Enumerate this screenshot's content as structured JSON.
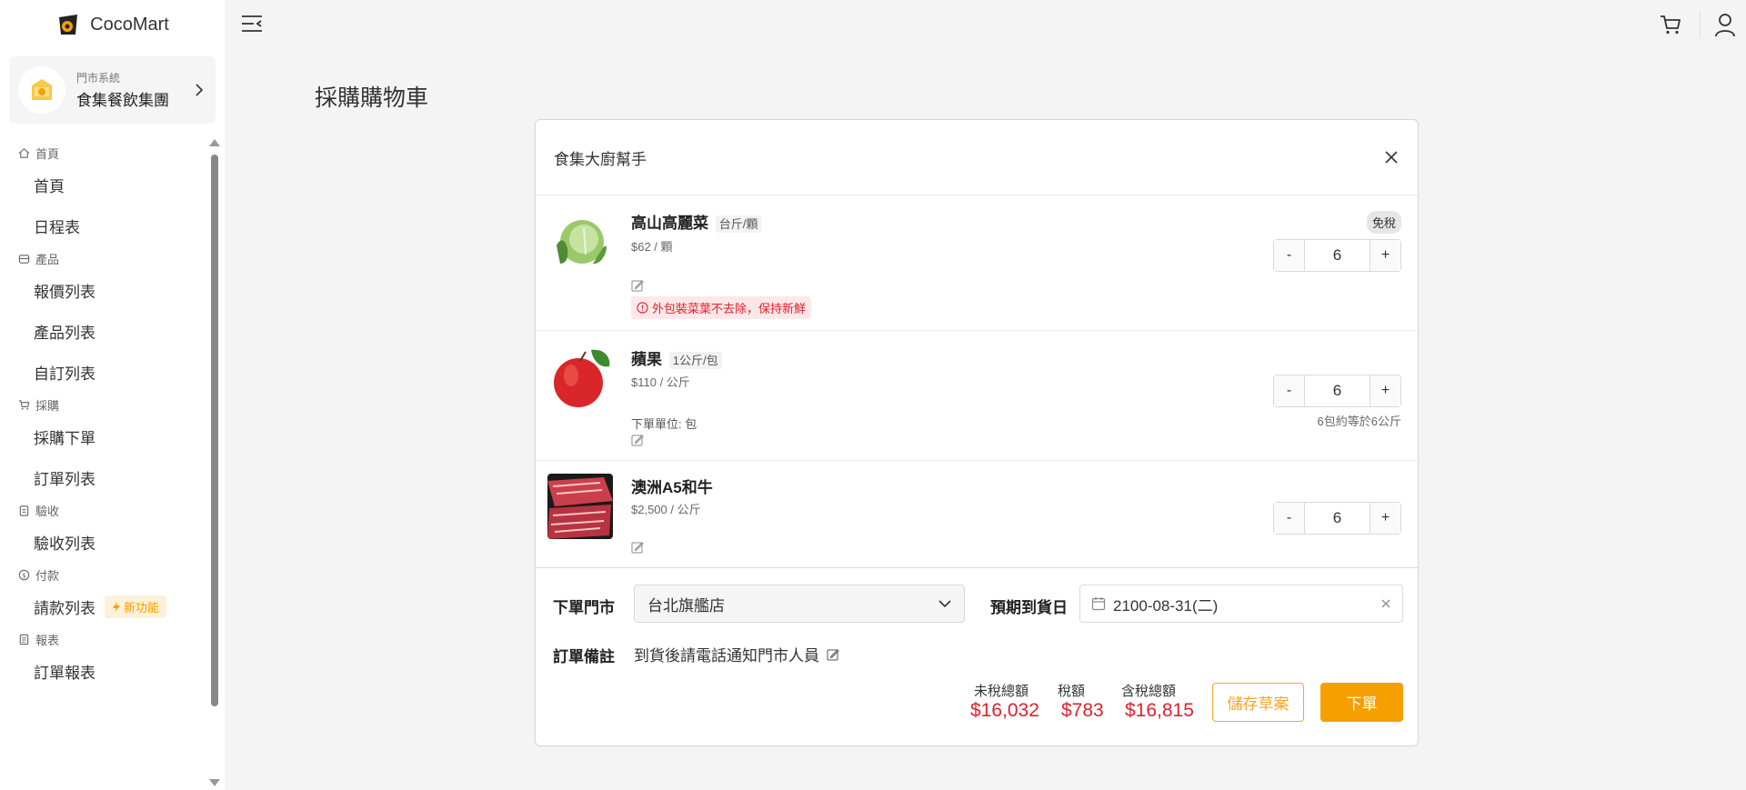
{
  "app": {
    "name": "CocoMart"
  },
  "org": {
    "subtitle": "門市系統",
    "name": "食集餐飲集團"
  },
  "menu": {
    "sections": [
      {
        "title": "首頁",
        "icon": "home-icon"
      },
      {
        "title": "產品",
        "icon": "box-icon"
      },
      {
        "title": "採購",
        "icon": "cart-icon"
      },
      {
        "title": "驗收",
        "icon": "clipboard-icon"
      },
      {
        "title": "付款",
        "icon": "dollar-icon"
      },
      {
        "title": "報表",
        "icon": "report-icon"
      }
    ],
    "items": {
      "home": "首頁",
      "schedule": "日程表",
      "quotes": "報價列表",
      "products": "產品列表",
      "custom": "自訂列表",
      "purchase_order": "採購下單",
      "orders": "訂單列表",
      "receiving": "驗收列表",
      "invoices": "請款列表",
      "order_report": "訂單報表"
    },
    "new_badge": "新功能"
  },
  "page": {
    "title": "採購購物車"
  },
  "cart": {
    "supplier": "食集大廚幫手",
    "items": [
      {
        "name": "高山高麗菜",
        "unit": "台斤/顆",
        "price": "$62 / 顆",
        "tax_badge": "免稅",
        "quantity": "6",
        "warning": "外包裝菜葉不去除，保持新鮮"
      },
      {
        "name": "蘋果",
        "unit": "1公斤/包",
        "price": "$110 / 公斤",
        "order_unit": "下單單位: 包",
        "quantity": "6",
        "conversion": "6包約等於6公斤"
      },
      {
        "name": "澳洲A5和牛",
        "price": "$2,500 / 公斤",
        "quantity": "6"
      }
    ],
    "minus": "-",
    "plus": "+"
  },
  "footer": {
    "store_label": "下單門市",
    "store_value": "台北旗艦店",
    "date_label": "預期到貨日",
    "date_value": "2100-08-31(二)",
    "note_label": "訂單備註",
    "note_value": "到貨後請電話通知門市人員",
    "subtotal_label": "未稅總額",
    "subtotal": "$16,032",
    "tax_label": "稅額",
    "tax": "$783",
    "total_label": "含稅總額",
    "total": "$16,815",
    "draft_button": "儲存草案",
    "order_button": "下單"
  },
  "colors": {
    "accent": "#f5a000",
    "price_red": "#e0202b"
  }
}
